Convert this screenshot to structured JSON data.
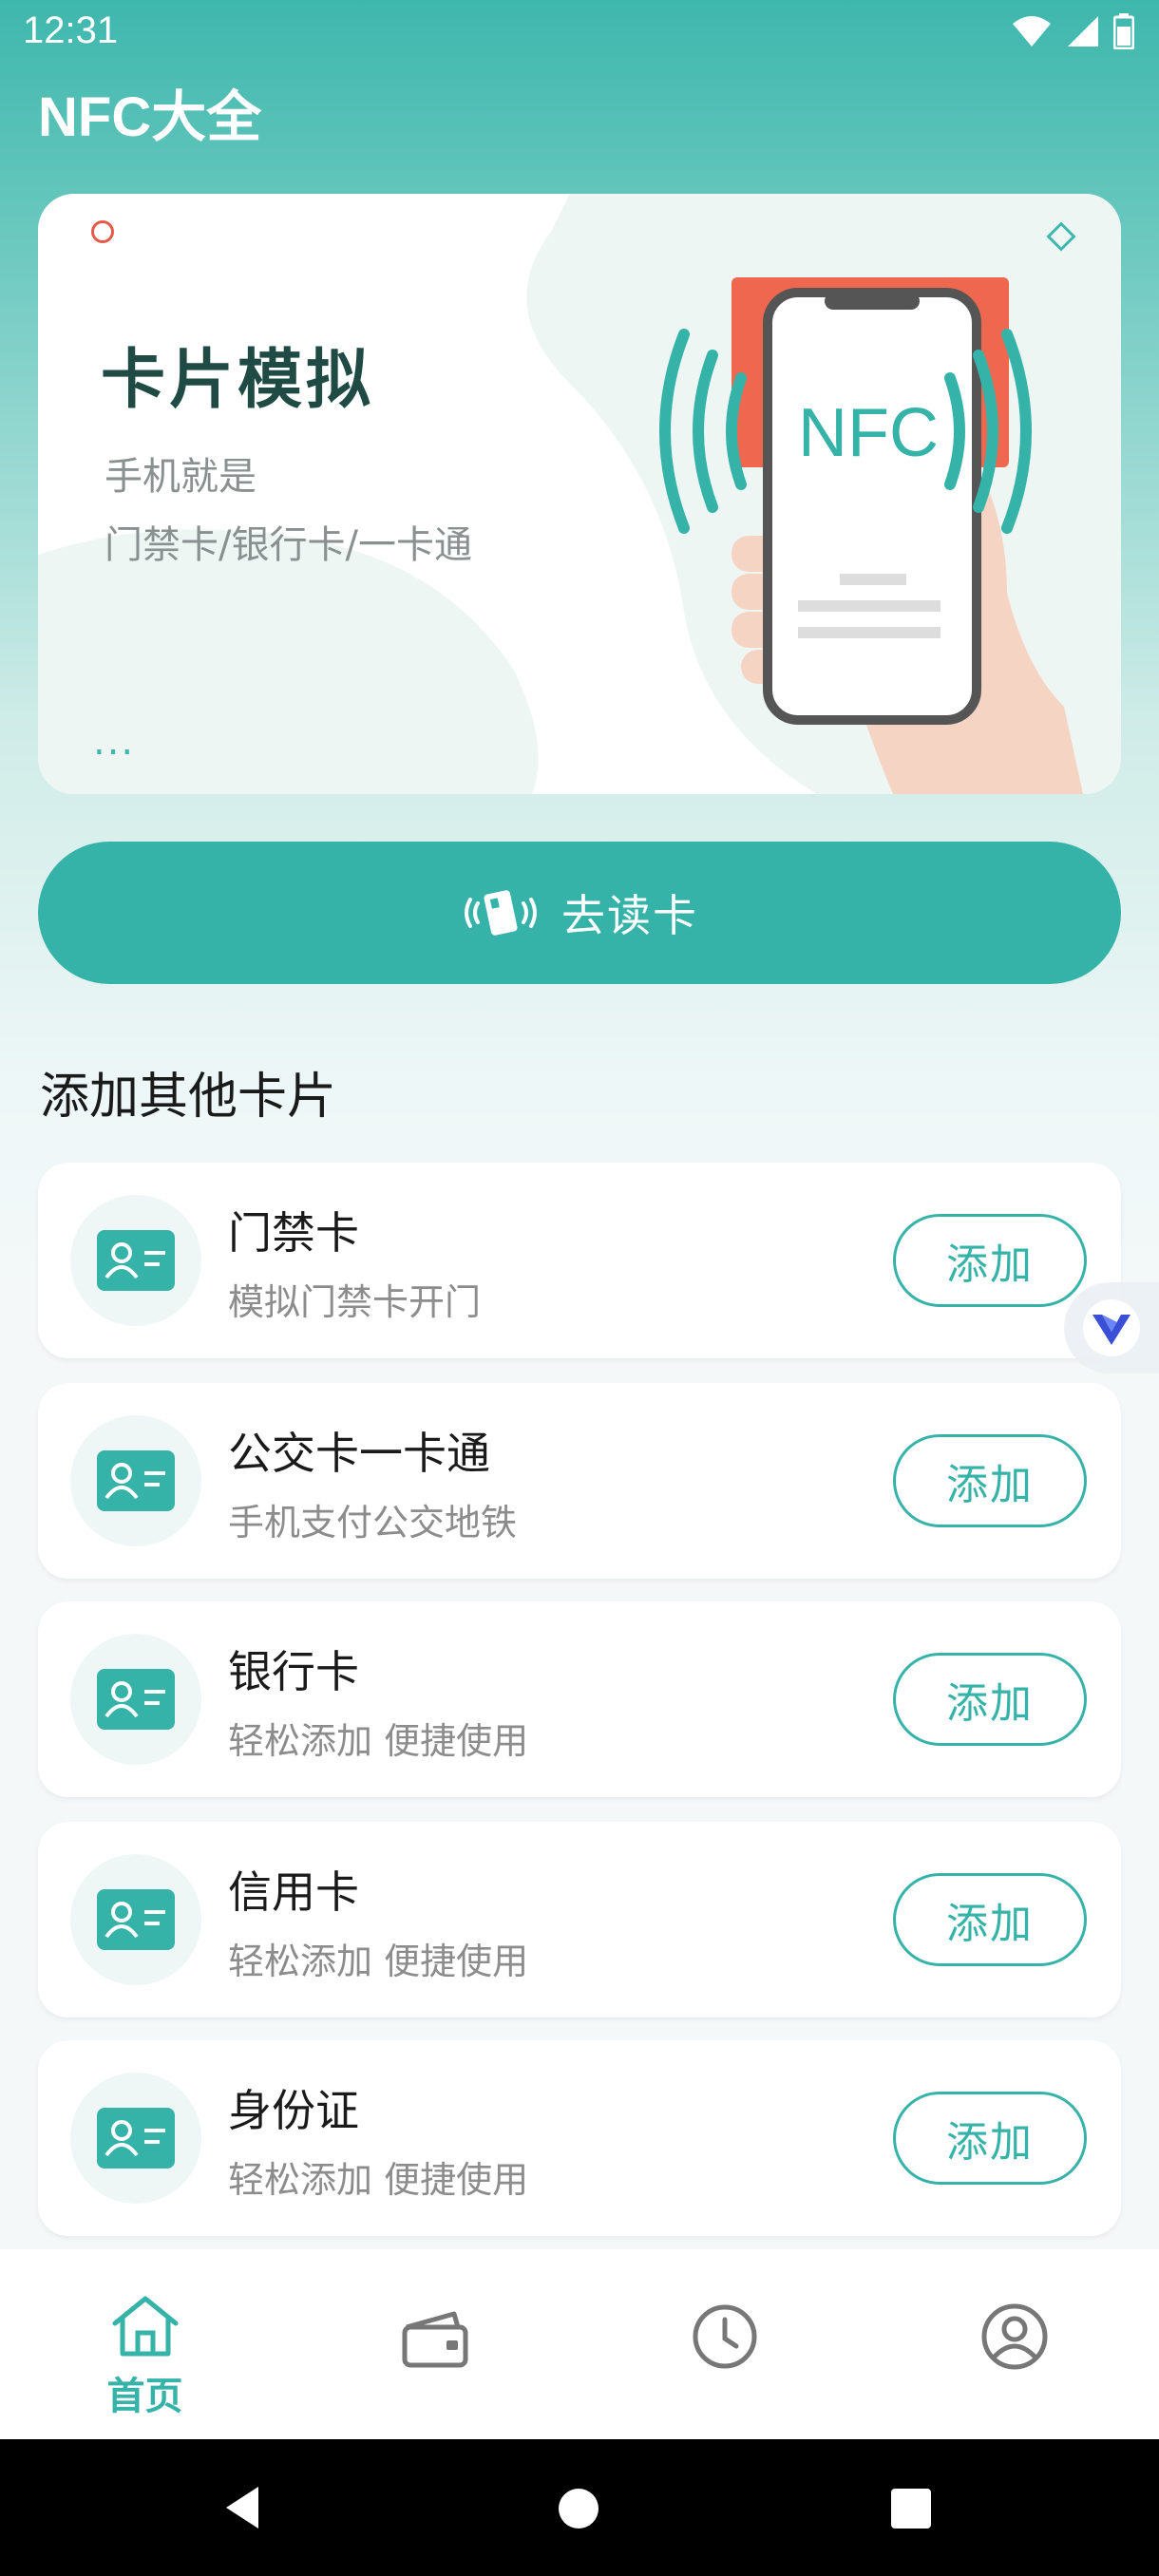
{
  "status_bar": {
    "time": "12:31"
  },
  "app": {
    "title": "NFC大全"
  },
  "hero": {
    "title": "卡片模拟",
    "subtitle_line1": "手机就是",
    "subtitle_line2": "门禁卡/银行卡/一卡通",
    "dots": "...",
    "illustration_text": "NFC"
  },
  "read_button": {
    "label": "去读卡"
  },
  "section": {
    "title": "添加其他卡片"
  },
  "cards": [
    {
      "name": "门禁卡",
      "desc": "模拟门禁卡开门",
      "action": "添加"
    },
    {
      "name": "公交卡一卡通",
      "desc": "手机支付公交地铁",
      "action": "添加"
    },
    {
      "name": "银行卡",
      "desc": "轻松添加 便捷使用",
      "action": "添加"
    },
    {
      "name": "信用卡",
      "desc": "轻松添加 便捷使用",
      "action": "添加"
    },
    {
      "name": "身份证",
      "desc": "轻松添加 便捷使用",
      "action": "添加"
    }
  ],
  "bottom_nav": {
    "items": [
      {
        "label": "首页",
        "icon": "home-icon",
        "active": true
      },
      {
        "label": "",
        "icon": "wallet-icon",
        "active": false
      },
      {
        "label": "",
        "icon": "clock-icon",
        "active": false
      },
      {
        "label": "",
        "icon": "profile-icon",
        "active": false
      }
    ]
  },
  "colors": {
    "accent": "#36b3a8",
    "header": "#3eb7ad",
    "hero_title": "#1f4b44"
  }
}
